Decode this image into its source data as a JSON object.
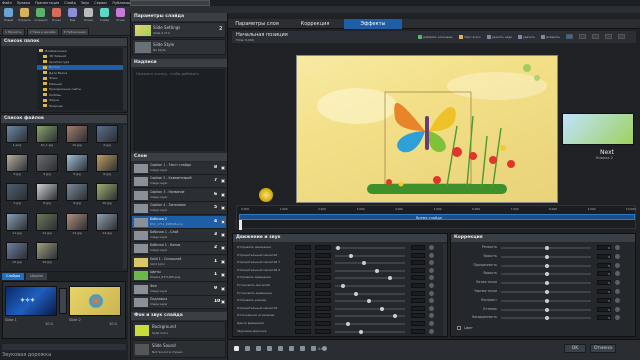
{
  "app": {
    "menu": [
      "Файл",
      "Правка",
      "Презентация",
      "Слайд",
      "Звук",
      "Сервис",
      "Публикация",
      "Справка"
    ],
    "toolbar": [
      "Новый",
      "Открыть",
      "Сохранить",
      "Показ",
      "Вид",
      "Опции",
      "Слайд",
      "Стиль"
    ],
    "tabs_top": [
      "1 Проекты",
      "2 Тема и дизайн",
      "3 Публикация"
    ],
    "bottom_caption": "Звуковая дорожка",
    "brand_color": "#5a0c0c",
    "accent_color": "#1e6fc4"
  },
  "left": {
    "folders_title": "Список папок",
    "folders": [
      "Изображения",
      "3D Зимний",
      "Архитектура",
      "Восток",
      "Дети Весна",
      "Фоны",
      "Малыши",
      "Праздничные сайты",
      "Любовь",
      "Фауна",
      "Природа"
    ],
    "files_title": "Список файлов",
    "files": [
      "1.png",
      "10_1.jpg",
      "10.jpg",
      "2.jpg",
      "3.jpg",
      "4.jpg",
      "5.jpg",
      "6.jpg",
      "7.jpg",
      "8.jpg",
      "9.jpg",
      "10.jpg",
      "11.jpg",
      "12.jpg",
      "13.jpg",
      "14.jpg",
      "15.jpg",
      "16.jpg"
    ],
    "slide_tabs": [
      "Слайды",
      "Шкала"
    ],
    "slides": [
      {
        "label": "Slide 1",
        "duration": "10.0"
      },
      {
        "label": "Slide 2",
        "duration": "10.0"
      }
    ]
  },
  "mid": {
    "slide_params_title": "Параметры слайда",
    "slide_items": [
      {
        "name": "Slide Settings",
        "sub": "Slide 2 of 2",
        "num": "2"
      },
      {
        "name": "Slide Style",
        "sub": "No Style",
        "num": ""
      }
    ],
    "captions_title": "Надписи",
    "caption_placeholder": "Нажмите кнопку, чтобы добавить",
    "layers_title": "Слои",
    "layers": [
      {
        "name": "Caption 1 - Текст слайда",
        "sub": "Image Layer",
        "num": "8"
      },
      {
        "name": "Caption 2 - Комментарий",
        "sub": "Image Layer",
        "num": "7"
      },
      {
        "name": "Caption 3 - Название",
        "sub": "Image Layer",
        "num": "6"
      },
      {
        "name": "Caption 4 - Заголовок",
        "sub": "Image Layer",
        "num": "5"
      },
      {
        "name": "Бабочка 2",
        "sub": "DSC_1711_008006.png",
        "num": "4"
      },
      {
        "name": "Бабочка 1 - Слой",
        "sub": "Image Layer",
        "num": "3"
      },
      {
        "name": "Бабочка 1 - Копия",
        "sub": "Image Layer",
        "num": "2"
      },
      {
        "name": "Solid 1 - Сплошной",
        "sub": "Solid Color",
        "num": "1"
      },
      {
        "name": "Цветы",
        "sub": "flowers_6371008.png",
        "num": "1"
      },
      {
        "name": "Фон",
        "sub": "Image Layer",
        "num": "9"
      },
      {
        "name": "Подложка",
        "sub": "Image Layer",
        "num": "10"
      }
    ],
    "bg_sound_title": "Фон и звук слайда",
    "bg_items": [
      {
        "name": "Background",
        "sub": "Solid Color"
      },
      {
        "name": "Slide Sound",
        "sub": "Not Sound is chosen"
      }
    ]
  },
  "right": {
    "tabs": [
      "Параметры слоя",
      "Коррекция",
      "Эффекты"
    ],
    "preview_title": "Начальная позиция",
    "preview_time": "Time: 0.000",
    "toolbar": [
      "добавить ключевые",
      "сброс всего",
      "удалить кадр",
      "удалить",
      "добавить"
    ],
    "next_label": "Next",
    "next_sub": "Кнопка 2",
    "timeline_ticks": [
      "0.000",
      "1.000",
      "2.000",
      "3.000",
      "4.000",
      "5.000",
      "6.000",
      "7.000",
      "8.000",
      "9.000",
      "10.000"
    ],
    "timeline_key": "Время слайда",
    "motion_title": "Движение и звук",
    "motion_rows": [
      "Отправить движение",
      "Отрицательный масштаб",
      "Отрицательный масштаб Y",
      "Отрицательный масштаб X",
      "Отправить вращение",
      "Установить масштаб",
      "Установить вращение",
      "Отправить размер",
      "Отрицательный масштаб",
      "Отложенное исчезание",
      "Центр вращения",
      "Звуковая дорожка"
    ],
    "correction_title": "Коррекция",
    "correction_rows": [
      "Резкость",
      "Яркость",
      "Прозрачность",
      "Яркость",
      "Белая точка",
      "Черная точка",
      "Контраст",
      "Оттенок",
      "Насыщенность"
    ],
    "correction_value": "0",
    "bottom_time": "0:00",
    "check_label": "Цвет",
    "ok_label": "OK",
    "cancel_label": "Отмена"
  }
}
